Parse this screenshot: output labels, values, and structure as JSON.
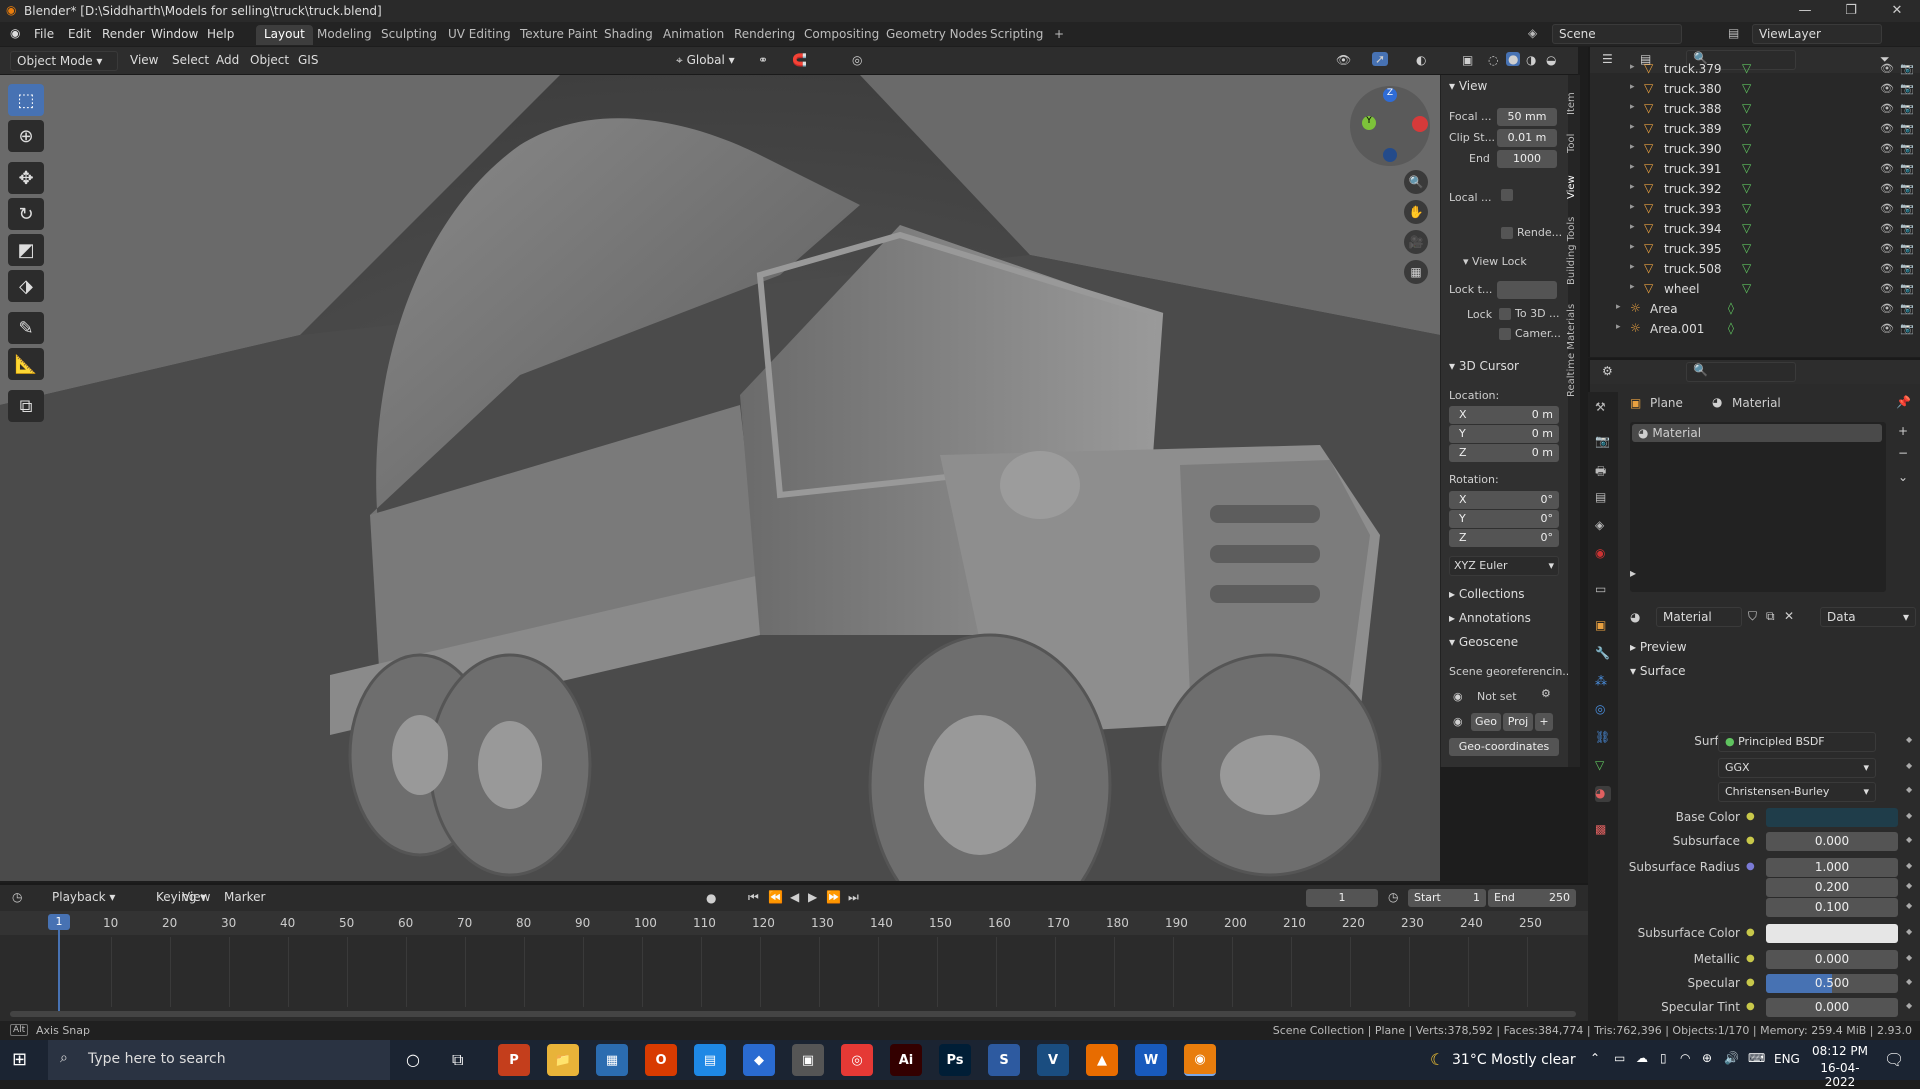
{
  "titlebar": {
    "title": "Blender* [D:\\Siddharth\\Models for selling\\truck\\truck.blend]",
    "minimize": "—",
    "maximize": "❐",
    "close": "✕"
  },
  "menu": {
    "items": [
      "File",
      "Edit",
      "Render",
      "Window",
      "Help"
    ]
  },
  "workspaces": {
    "tabs": [
      "Layout",
      "Modeling",
      "Sculpting",
      "UV Editing",
      "Texture Paint",
      "Shading",
      "Animation",
      "Rendering",
      "Compositing",
      "Geometry Nodes",
      "Scripting"
    ],
    "active": "Layout",
    "add": "+"
  },
  "scene": {
    "scene_label": "Scene",
    "viewlayer_label": "ViewLayer"
  },
  "header3d": {
    "mode": "Object Mode",
    "view": "View",
    "select": "Select",
    "add": "Add",
    "object": "Object",
    "gis": "GIS",
    "orientation": "Global"
  },
  "npanel": {
    "tabs": [
      "Item",
      "Tool",
      "View",
      "Building Tools",
      "Realtime Materials"
    ],
    "view_title": "View",
    "focal_label": "Focal ...",
    "focal_value": "50 mm",
    "clip_start_label": "Clip St...",
    "clip_start_value": "0.01 m",
    "end_label": "End",
    "end_value": "1000",
    "local_label": "Local ...",
    "render_label": "Rende...",
    "view_lock_title": "View Lock",
    "lock_to_label": "Lock t...",
    "lock_label": "Lock",
    "to3d_label": "To 3D ...",
    "camera_label": "Camer...",
    "cursor_title": "3D Cursor",
    "location_label": "Location:",
    "rotation_label": "Rotation:",
    "loc": [
      {
        "axis": "X",
        "value": "0 m"
      },
      {
        "axis": "Y",
        "value": "0 m"
      },
      {
        "axis": "Z",
        "value": "0 m"
      }
    ],
    "rot": [
      {
        "axis": "X",
        "value": "0°"
      },
      {
        "axis": "Y",
        "value": "0°"
      },
      {
        "axis": "Z",
        "value": "0°"
      }
    ],
    "euler": "XYZ Euler",
    "collections": "Collections",
    "annotations": "Annotations",
    "geoscene": "Geoscene",
    "georef": "Scene georeferencin...",
    "not_set": "Not set",
    "geo": "Geo",
    "proj": "Proj",
    "geo_coords": "Geo-coordinates"
  },
  "outliner": {
    "rows": [
      {
        "name": "truck.379",
        "type": "mesh"
      },
      {
        "name": "truck.380",
        "type": "mesh"
      },
      {
        "name": "truck.388",
        "type": "mesh"
      },
      {
        "name": "truck.389",
        "type": "mesh"
      },
      {
        "name": "truck.390",
        "type": "mesh"
      },
      {
        "name": "truck.391",
        "type": "mesh"
      },
      {
        "name": "truck.392",
        "type": "mesh"
      },
      {
        "name": "truck.393",
        "type": "mesh"
      },
      {
        "name": "truck.394",
        "type": "mesh"
      },
      {
        "name": "truck.395",
        "type": "mesh"
      },
      {
        "name": "truck.508",
        "type": "mesh"
      },
      {
        "name": "wheel",
        "type": "mesh"
      },
      {
        "name": "Area",
        "type": "light"
      },
      {
        "name": "Area.001",
        "type": "light"
      }
    ]
  },
  "properties": {
    "breadcrumb_object": "Plane",
    "breadcrumb_material": "Material",
    "slot": "Material",
    "material_name": "Material",
    "data": "Data",
    "preview": "Preview",
    "surface_section": "Surface",
    "rows": [
      {
        "label": "Surface",
        "value": "Principled BSDF"
      },
      {
        "label": "",
        "value": "GGX"
      },
      {
        "label": "",
        "value": "Christensen-Burley"
      },
      {
        "label": "Base Color",
        "value": ""
      },
      {
        "label": "Subsurface",
        "value": "0.000"
      },
      {
        "label": "Subsurface Radius",
        "value": "1.000"
      },
      {
        "label": "",
        "value": "0.200"
      },
      {
        "label": "",
        "value": "0.100"
      },
      {
        "label": "Subsurface Color",
        "value": ""
      },
      {
        "label": "Metallic",
        "value": "0.000"
      },
      {
        "label": "Specular",
        "value": "0.500"
      },
      {
        "label": "Specular Tint",
        "value": "0.000"
      }
    ],
    "base_color": "#1f3d4a",
    "subsurface_color": "#e6e6e6",
    "specular_fill": 0.5
  },
  "timeline": {
    "playback": "Playback",
    "keying": "Keying",
    "view": "View",
    "marker": "Marker",
    "current_frame": "1",
    "start_label": "Start",
    "start": "1",
    "end_label": "End",
    "end": "250",
    "ticks": [
      "1",
      "10",
      "20",
      "30",
      "40",
      "50",
      "60",
      "70",
      "80",
      "90",
      "100",
      "110",
      "120",
      "130",
      "140",
      "150",
      "160",
      "170",
      "180",
      "190",
      "200",
      "210",
      "220",
      "230",
      "240",
      "250"
    ]
  },
  "statusbar": {
    "left": "Axis Snap",
    "right": "Scene Collection | Plane | Verts:378,592 | Faces:384,774 | Tris:762,396 | Objects:1/170 | Memory: 259.4 MiB | 2.93.0"
  },
  "taskbar": {
    "search": "Type here to search",
    "weather": "31°C  Mostly clear",
    "lang": "ENG",
    "time": "08:12 PM",
    "date": "16-04-2022",
    "apps": [
      {
        "name": "P",
        "color": "#c43e1c"
      },
      {
        "name": "📁",
        "color": "#e8b339"
      },
      {
        "name": "▦",
        "color": "#2b6cb0"
      },
      {
        "name": "O",
        "color": "#d83b01"
      },
      {
        "name": "▤",
        "color": "#1e88e5"
      },
      {
        "name": "◆",
        "color": "#2a6bd1"
      },
      {
        "name": "▣",
        "color": "#555"
      },
      {
        "name": "◎",
        "color": "#e53935"
      },
      {
        "name": "Ai",
        "color": "#330000"
      },
      {
        "name": "Ps",
        "color": "#001e36"
      },
      {
        "name": "S",
        "color": "#2d5aa0"
      },
      {
        "name": "V",
        "color": "#1a4d80"
      },
      {
        "name": "▲",
        "color": "#e86c00"
      },
      {
        "name": "W",
        "color": "#185abd"
      },
      {
        "name": "◉",
        "color": "#e87d0d"
      }
    ]
  }
}
